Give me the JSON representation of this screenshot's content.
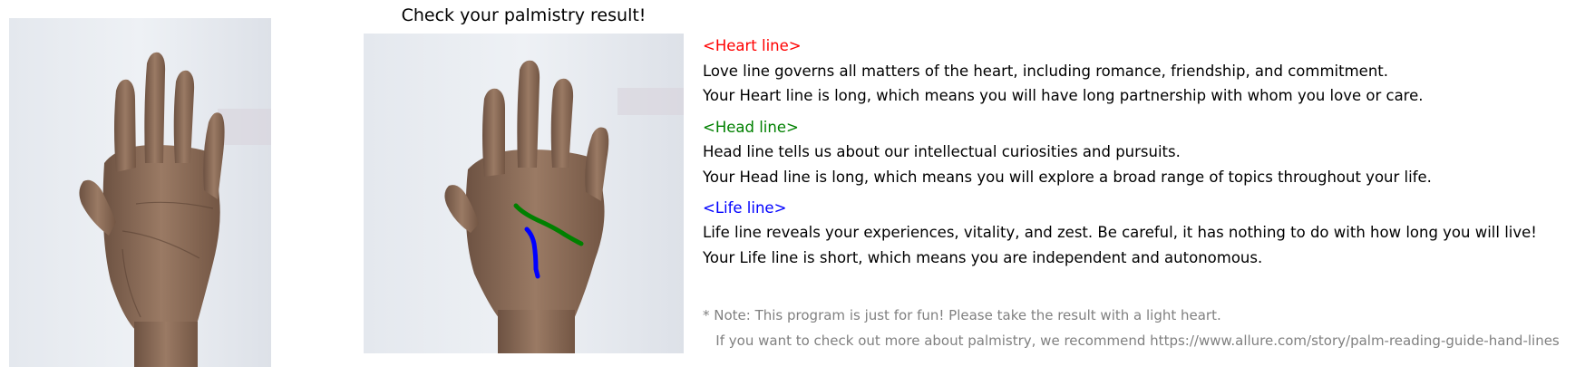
{
  "result": {
    "title": "Check your palmistry result!"
  },
  "photos": {
    "original": "hand-photo",
    "result": "hand-photo-with-lines"
  },
  "colors": {
    "heart": "#ff0000",
    "head": "#008000",
    "life": "#0000ff",
    "note": "#808080"
  },
  "lines": [
    {
      "heading": "<Heart line>",
      "description": "Love line governs all matters of the heart, including romance, friendship, and commitment.",
      "verdict": "Your Heart line is long, which means you will have long partnership with whom you love or care."
    },
    {
      "heading": "<Head line>",
      "description": "Head line tells us about our intellectual curiosities and pursuits.",
      "verdict": "Your Head line is long, which means you will explore a broad range of topics throughout your life."
    },
    {
      "heading": "<Life line>",
      "description": "Life line reveals your experiences, vitality, and zest. Be careful, it has nothing to do with how long you will live!",
      "verdict": "Your Life line is short, which means you are independent and autonomous."
    }
  ],
  "note": {
    "line1": "* Note: This program is just for fun! Please take the result with a light heart.",
    "line2": "   If you want to check out more about palmistry, we recommend https://www.allure.com/story/palm-reading-guide-hand-lines"
  }
}
